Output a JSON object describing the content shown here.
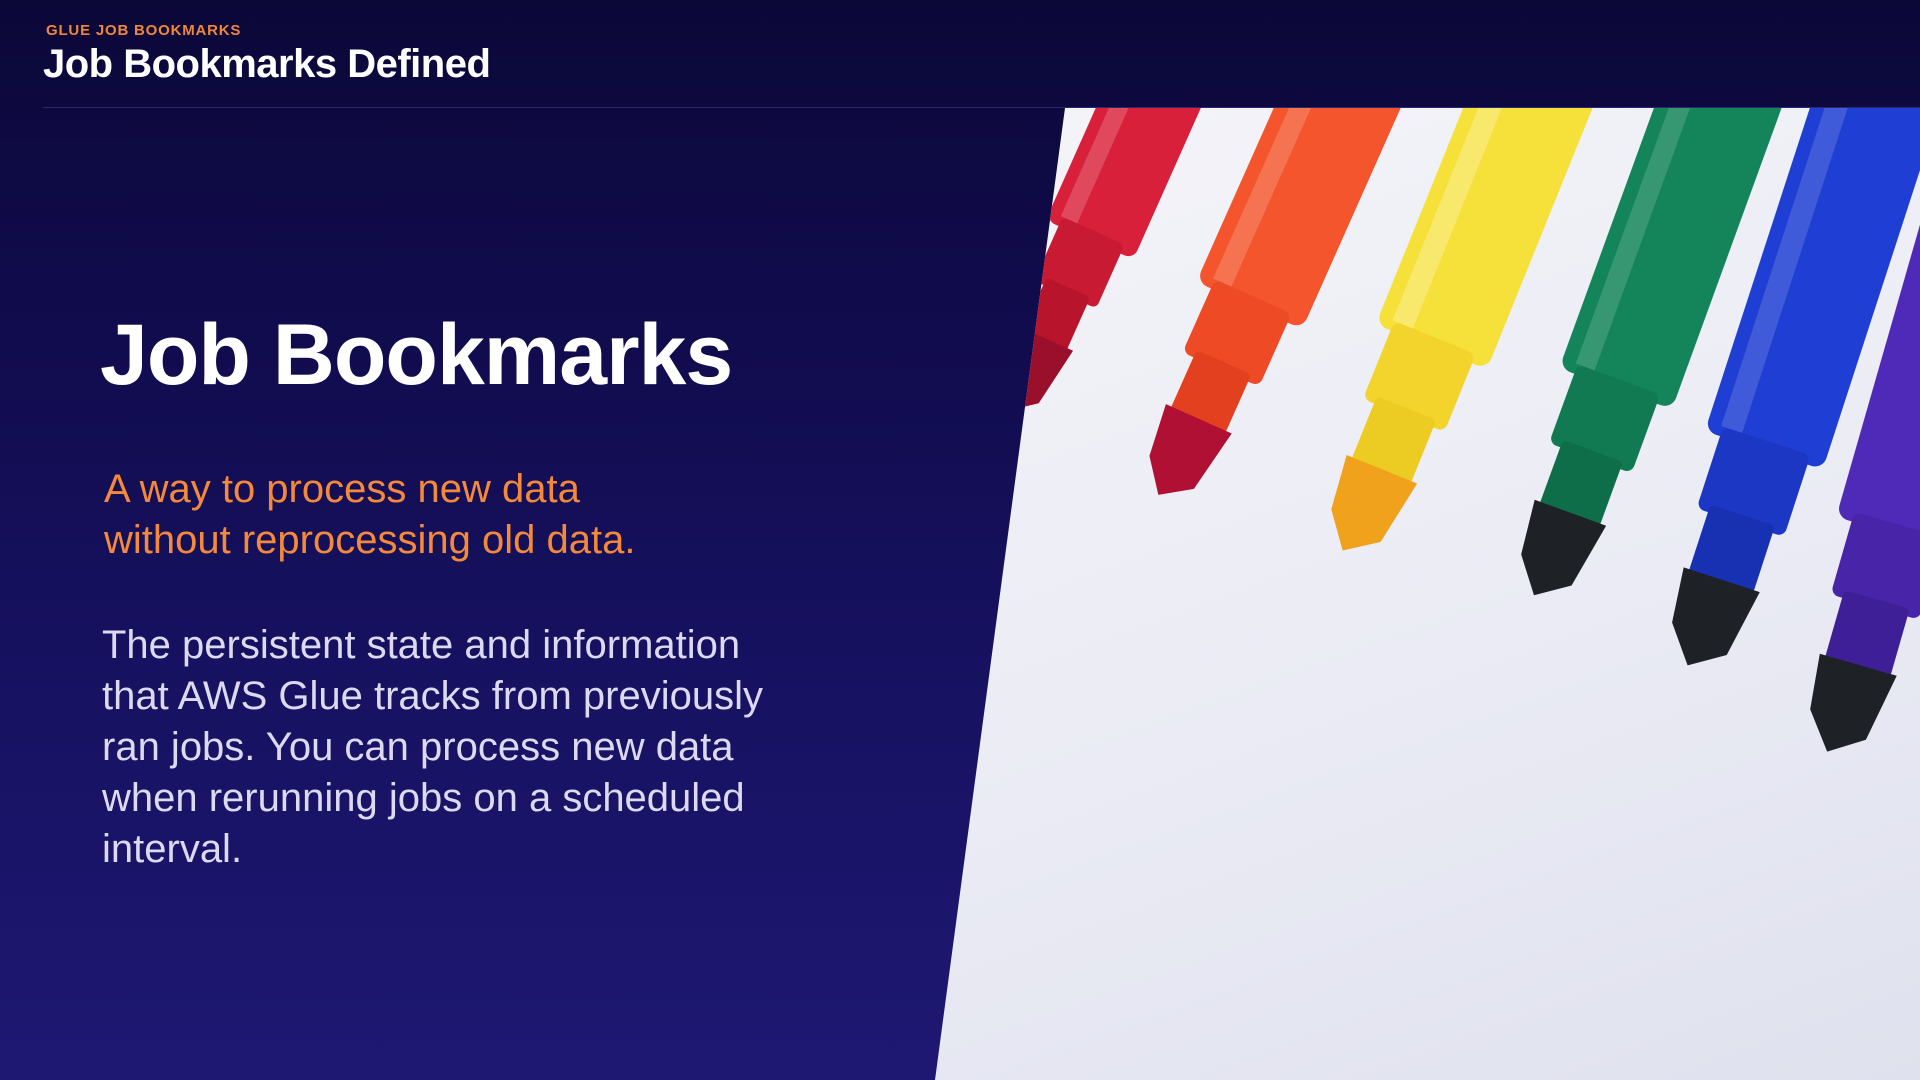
{
  "header": {
    "kicker": "GLUE JOB BOOKMARKS",
    "title": "Job Bookmarks Defined"
  },
  "slide": {
    "title": "Job Bookmarks",
    "subtitle_line1": "A way to process new data",
    "subtitle_line2": "without reprocessing old data.",
    "body_line1": "The persistent state and information",
    "body_line2": "that AWS Glue tracks from previously",
    "body_line3": "ran jobs. You can process new data",
    "body_line4": "when rerunning jobs on a scheduled",
    "body_line5": "interval."
  },
  "photo": {
    "subject": "markers-photo",
    "marker_colors": [
      "#d8203a",
      "#f4552c",
      "#f6e03a",
      "#14855a",
      "#1f3fd4",
      "#4f2ab8"
    ]
  },
  "colors": {
    "background": "#100b4a",
    "accent": "#f0863a",
    "title": "#ffffff",
    "body": "#dcdaf0"
  }
}
